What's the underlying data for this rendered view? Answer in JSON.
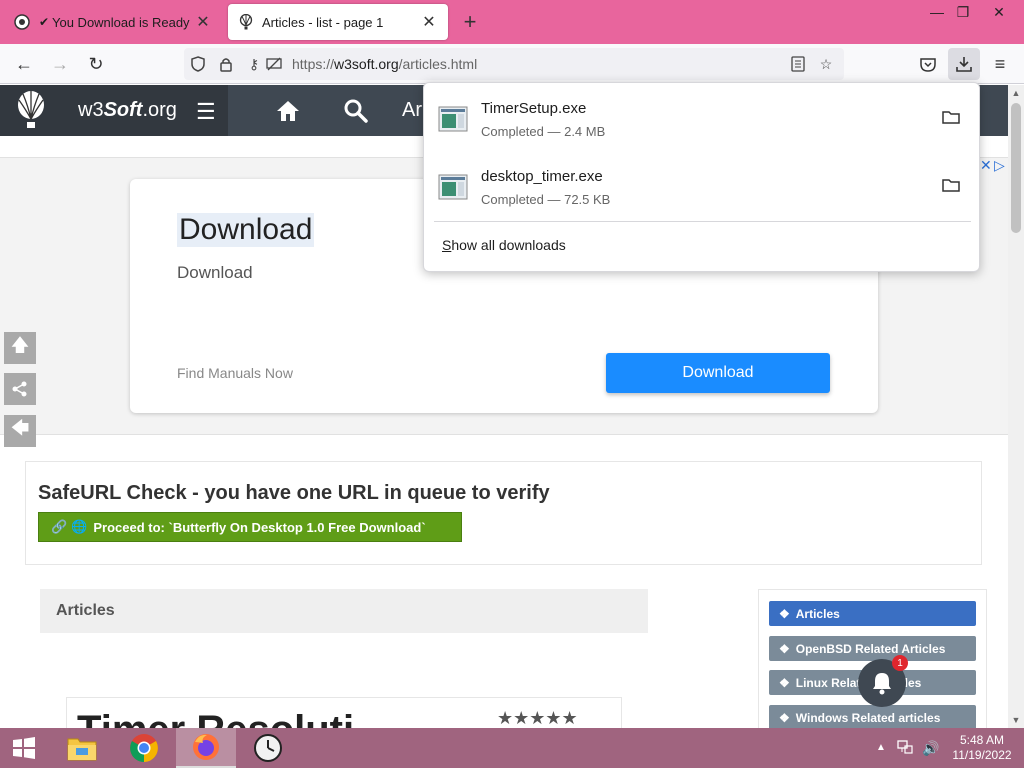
{
  "browser": {
    "tabs": [
      {
        "title": "You Download is Ready",
        "favicon": "site-logo-icon"
      },
      {
        "title": "Articles - list - page 1",
        "favicon": "balloon-icon",
        "active": true
      }
    ],
    "window_controls": [
      "minimize-icon",
      "restore-icon",
      "close-icon"
    ],
    "url_scheme": "https://",
    "url_domain": "w3soft.org",
    "url_path": "/articles.html"
  },
  "site": {
    "brand_prefix": "w3",
    "brand_main": "Soft",
    "brand_suffix": ".org",
    "nav_text": "Ar"
  },
  "ad": {
    "title": "Download",
    "subtitle": "Download",
    "find_text": "Find Manuals Now",
    "button_label": "Download",
    "close_glyph": "✕",
    "info_glyph": "▷"
  },
  "safeurl": {
    "heading": "SafeURL Check - you have one URL in queue to verify",
    "proceed_label": "Proceed to: `Butterfly On Desktop 1.0 Free Download`"
  },
  "articles": {
    "heading": "Articles",
    "card_title": "Timer Resoluti",
    "stars": "★★★★★"
  },
  "sidebar_links": [
    {
      "label": "Articles",
      "style": "blue"
    },
    {
      "label": "OpenBSD Related Articles",
      "style": "gray"
    },
    {
      "label": "Linux Related Articles",
      "style": "gray"
    },
    {
      "label": "Windows Related articles",
      "style": "gray"
    }
  ],
  "notification": {
    "count": "1"
  },
  "downloads": {
    "items": [
      {
        "name": "TimerSetup.exe",
        "status": "Completed — 2.4 MB"
      },
      {
        "name": "desktop_timer.exe",
        "status": "Completed — 72.5 KB"
      }
    ],
    "show_all_prefix": "S",
    "show_all_rest": "how all downloads"
  },
  "taskbar": {
    "apps": [
      "file-explorer-icon",
      "chrome-icon",
      "firefox-icon",
      "clock-app-icon"
    ],
    "time": "5:48 AM",
    "date": "11/19/2022"
  },
  "colors": {
    "tabstrip": "#e8659d",
    "taskbar": "#a0647f",
    "ad_button": "#1a8cff",
    "proceed": "#5f9d17",
    "sidelink_blue": "#3a6fc3"
  }
}
